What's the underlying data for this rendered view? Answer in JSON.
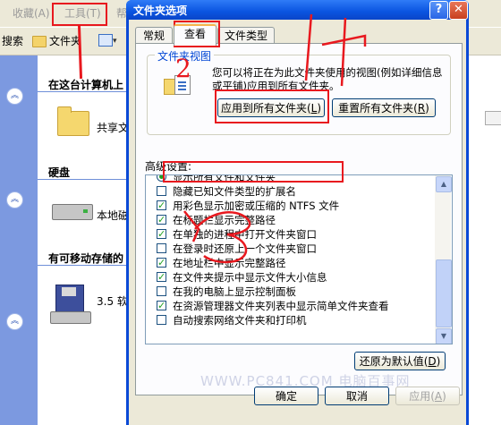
{
  "background": {
    "menu": [
      "收藏(A)",
      "工具(T)",
      "帮"
    ],
    "toolbar": {
      "search": "搜索",
      "folders": "文件夹",
      "view_dropdown": "▾"
    },
    "sections": {
      "this_computer": "在这台计算机上",
      "hard_disk": "硬盘",
      "removable": "有可移动存储的"
    },
    "items": {
      "shared_folder": "共享文",
      "local_disk": "本地磁",
      "floppy": "3.5 软"
    }
  },
  "dialog": {
    "title": "文件夹选项",
    "help_button": "?",
    "close_button": "✕",
    "tabs": [
      "常规",
      "查看",
      "文件类型"
    ],
    "folder_views": {
      "legend": "文件夹视图",
      "description": "您可以将正在为此文件夹使用的视图(例如详细信息或平铺)应用到所有文件夹。",
      "apply_all": "应用到所有文件夹(",
      "apply_all_key": "L",
      "reset_all": "重置所有文件夹(",
      "reset_all_key": "R"
    },
    "advanced_label": "高级设置:",
    "advanced_items": [
      {
        "type": "radio",
        "checked": true,
        "label": "显示所有文件和文件夹"
      },
      {
        "type": "checkbox",
        "checked": false,
        "label": "隐藏已知文件类型的扩展名"
      },
      {
        "type": "checkbox",
        "checked": true,
        "label": "用彩色显示加密或压缩的 NTFS 文件"
      },
      {
        "type": "checkbox",
        "checked": true,
        "label": "在标题栏显示完整路径"
      },
      {
        "type": "checkbox",
        "checked": true,
        "label": "在单独的进程中打开文件夹窗口"
      },
      {
        "type": "checkbox",
        "checked": false,
        "label": "在登录时还原上一个文件夹窗口"
      },
      {
        "type": "checkbox",
        "checked": true,
        "label": "在地址栏中显示完整路径"
      },
      {
        "type": "checkbox",
        "checked": true,
        "label": "在文件夹提示中显示文件大小信息"
      },
      {
        "type": "checkbox",
        "checked": false,
        "label": "在我的电脑上显示控制面板"
      },
      {
        "type": "checkbox",
        "checked": true,
        "label": "在资源管理器文件夹列表中显示简单文件夹查看"
      },
      {
        "type": "checkbox",
        "checked": false,
        "label": "自动搜索网络文件夹和打印机"
      }
    ],
    "restore_defaults": "还原为默认值(",
    "restore_defaults_key": "D",
    "ok": "确定",
    "cancel": "取消",
    "apply": "应用(",
    "apply_key": "A"
  },
  "annotations": {
    "step_2": "2",
    "watermark": "WWW.PC841.COM 电脑百事网"
  },
  "colors": {
    "annotation": "#e8181e",
    "xp_title": "#0a54e0",
    "check_green": "#21a121"
  }
}
